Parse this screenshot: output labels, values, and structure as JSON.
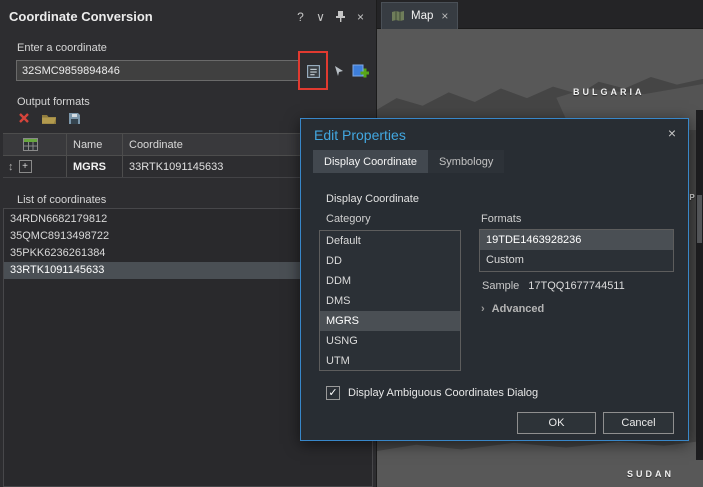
{
  "colors": {
    "accent": "#42a7e0",
    "dialog-border": "#3887c9",
    "dialog-bg": "#282d33",
    "panel-bg": "#2d2d30",
    "selection": "#4a4f54",
    "highlight-red": "#e13a30",
    "map-bg": "#454545",
    "land": "#585858"
  },
  "icons": {
    "help": "?",
    "menu_chevron": "∨",
    "close": "×",
    "updown": "↕",
    "expand_plus": "+",
    "advanced_chevron": "›",
    "check": "✓"
  },
  "panel": {
    "title": "Coordinate Conversion",
    "input_label": "Enter a coordinate",
    "input_value": "32SMC9859894846",
    "output_formats_label": "Output formats",
    "table": {
      "name_header": "Name",
      "coordinate_header": "Coordinate",
      "rows": [
        {
          "name": "MGRS",
          "coordinate": "33RTK1091145633"
        }
      ]
    },
    "list_label": "List of coordinates",
    "list_items": [
      "34RDN6682179812",
      "35QMC8913498722",
      "35PKK6236261384",
      "33RTK1091145633"
    ]
  },
  "map": {
    "tab_label": "Map",
    "label_bulgaria": "BULGARIA",
    "label_sudan": "SUDAN",
    "label_partial": "YP"
  },
  "dialog": {
    "title": "Edit Properties",
    "tab_display": "Display Coordinate",
    "tab_symbology": "Symbology",
    "group_label": "Display Coordinate",
    "category_label": "Category",
    "categories": [
      "Default",
      "DD",
      "DDM",
      "DMS",
      "MGRS",
      "USNG",
      "UTM"
    ],
    "formats_label": "Formats",
    "formats": [
      "19TDE1463928236",
      "Custom"
    ],
    "sample_label": "Sample",
    "sample_value": "17TQQ1677744511",
    "advanced_label": "Advanced",
    "ambiguous_label": "Display Ambiguous Coordinates Dialog",
    "ok": "OK",
    "cancel": "Cancel"
  }
}
